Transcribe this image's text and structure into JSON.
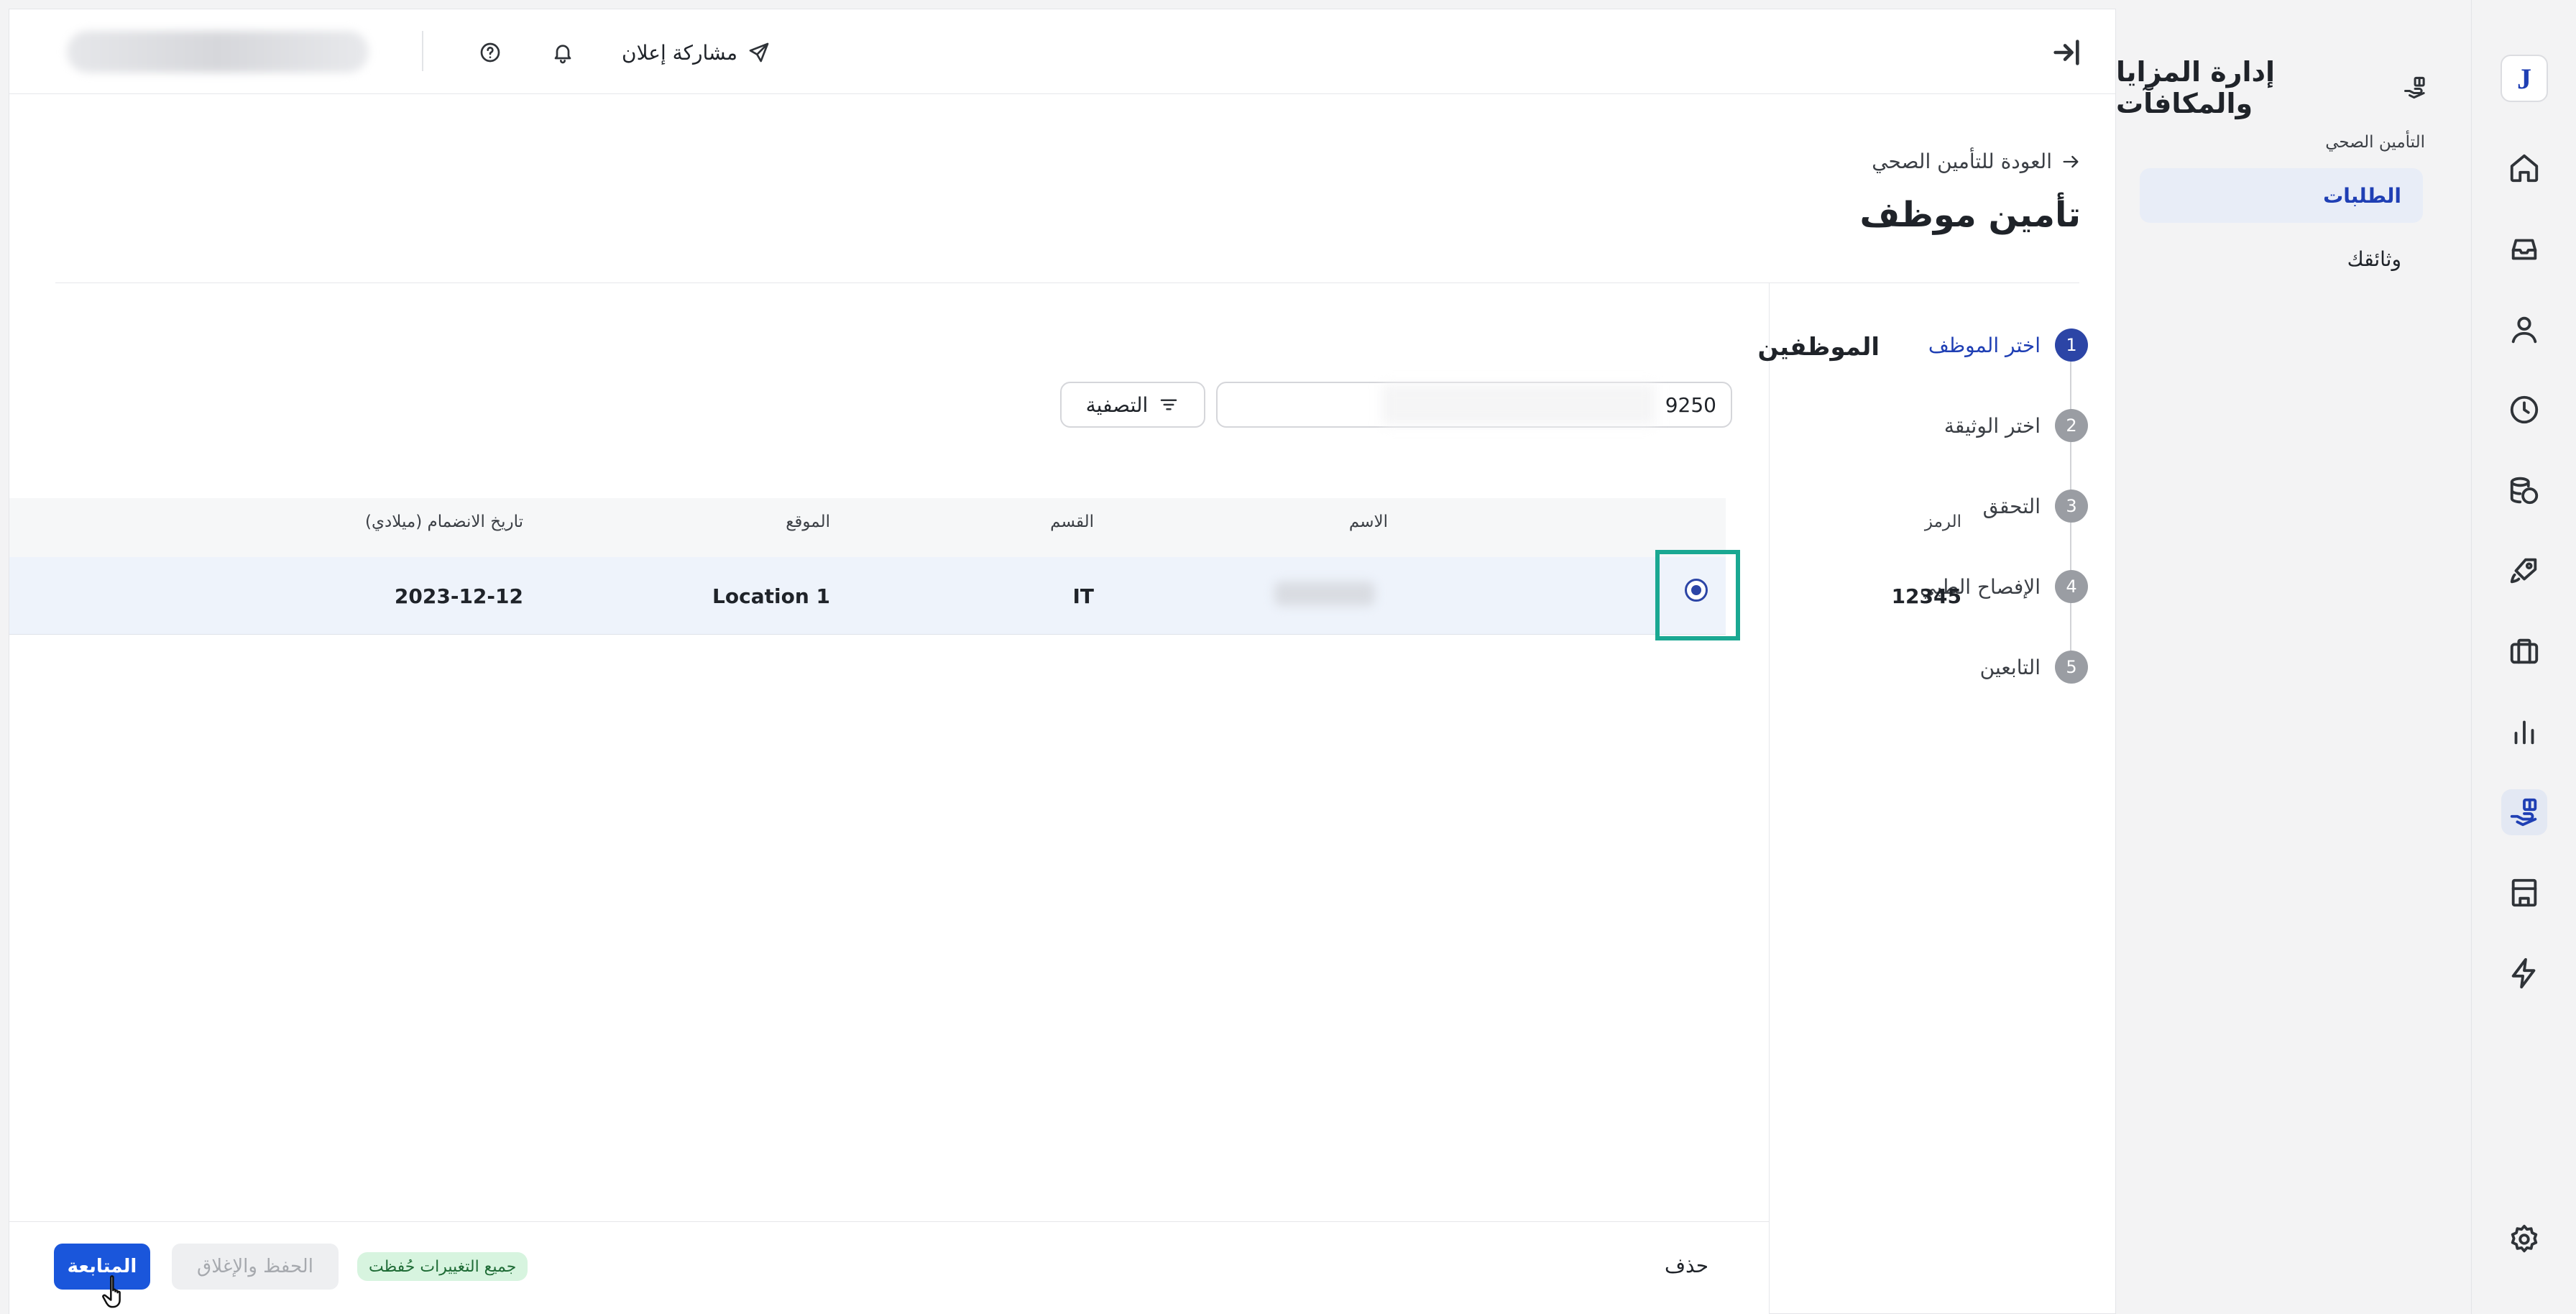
{
  "colors": {
    "primary": "#1a56db",
    "accent": "#2c45a6",
    "highlight_box": "#1aa892",
    "saved_badge_bg": "#d7f4df"
  },
  "rail": {
    "logo_letter": "J",
    "icons": [
      "home-icon",
      "inbox-icon",
      "user-icon",
      "clock-icon",
      "coins-icon",
      "rocket-icon",
      "briefcase-icon",
      "bar-chart-icon",
      "benefits-hand-icon",
      "building-icon",
      "bolt-icon",
      "settings-icon"
    ],
    "active": "benefits-hand-icon"
  },
  "subnav": {
    "title": "إدارة المزايا والمكافآت",
    "section": "التأمين الصحي",
    "items": [
      {
        "label": "الطلبات",
        "active": true
      },
      {
        "label": "وثائقك",
        "active": false
      }
    ]
  },
  "topbar": {
    "share_label": "مشاركة إعلان"
  },
  "page": {
    "back_label": "العودة للتأمين الصحي",
    "title": "تأمين موظف"
  },
  "steps": [
    {
      "num": "1",
      "label": "اختر الموظف",
      "active": true
    },
    {
      "num": "2",
      "label": "اختر الوثيقة",
      "active": false
    },
    {
      "num": "3",
      "label": "التحقق",
      "active": false
    },
    {
      "num": "4",
      "label": "الإفصاح الطبي",
      "active": false
    },
    {
      "num": "5",
      "label": "التابعين",
      "active": false
    }
  ],
  "employees": {
    "title": "الموظفين",
    "search_value": "9250",
    "filter_label": "التصفية",
    "columns": [
      "الرمز",
      "الاسم",
      "القسم",
      "الموقع",
      "تاريخ الانضمام (ميلادي)"
    ],
    "rows": [
      {
        "code": "12345",
        "department": "IT",
        "location": "Location 1",
        "join_date": "2023-12-12",
        "selected": true
      }
    ]
  },
  "footer": {
    "delete_label": "حذف",
    "continue_label": "المتابعة",
    "save_close_label": "الحفظ والإغلاق",
    "saved_status": "جميع التغييرات حُفظت"
  }
}
